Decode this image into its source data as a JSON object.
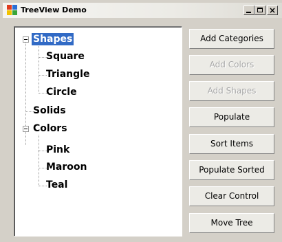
{
  "window": {
    "title": "TreeView Demo",
    "controls": {
      "minimize": "_",
      "maximize": "□",
      "close": "×"
    }
  },
  "tree": {
    "nodes": [
      {
        "label": "Shapes",
        "selected": true,
        "expanded": true,
        "children": [
          {
            "label": "Square"
          },
          {
            "label": "Triangle"
          },
          {
            "label": "Circle"
          }
        ]
      },
      {
        "label": "Solids",
        "selected": false,
        "expanded": false,
        "children": []
      },
      {
        "label": "Colors",
        "selected": false,
        "expanded": true,
        "children": [
          {
            "label": "Pink"
          },
          {
            "label": "Maroon"
          },
          {
            "label": "Teal"
          }
        ]
      }
    ]
  },
  "buttons": [
    {
      "label": "Add Categories",
      "enabled": true
    },
    {
      "label": "Add Colors",
      "enabled": false
    },
    {
      "label": "Add Shapes",
      "enabled": false
    },
    {
      "label": "Populate",
      "enabled": true
    },
    {
      "label": "Sort Items",
      "enabled": true
    },
    {
      "label": "Populate Sorted",
      "enabled": true
    },
    {
      "label": "Clear Control",
      "enabled": true
    },
    {
      "label": "Move Tree",
      "enabled": true
    }
  ],
  "colors": {
    "window_bg": "#d4d0c8",
    "selection_bg": "#316ac5",
    "disabled_text": "#a8a8a8"
  }
}
